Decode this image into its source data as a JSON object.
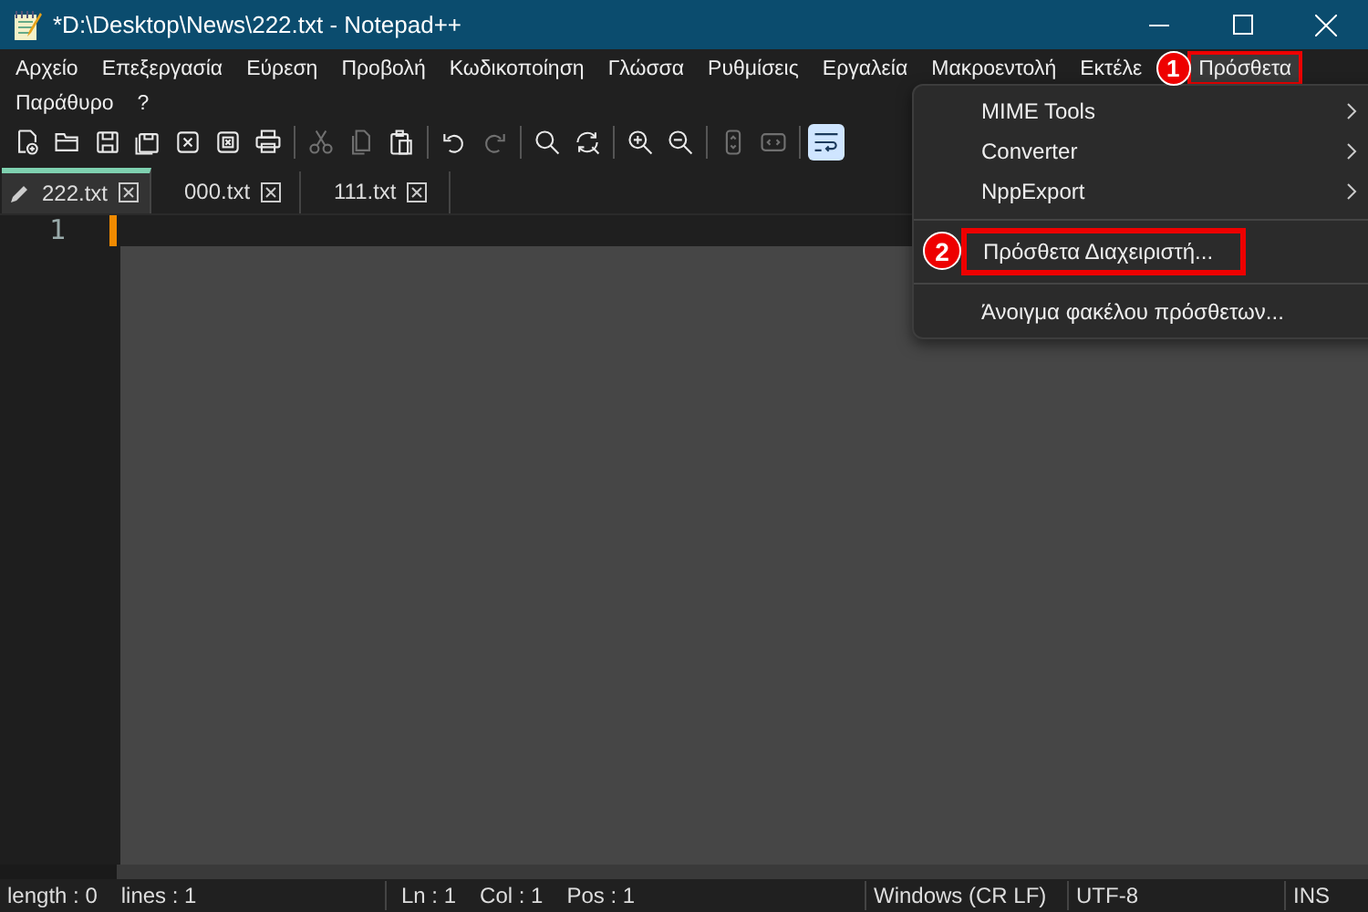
{
  "window": {
    "title": "*D:\\Desktop\\News\\222.txt - Notepad++"
  },
  "menubar": [
    {
      "label": "Αρχείο",
      "selected": false
    },
    {
      "label": "Επεξεργασία",
      "selected": false
    },
    {
      "label": "Εύρεση",
      "selected": false
    },
    {
      "label": "Προβολή",
      "selected": false
    },
    {
      "label": "Κωδικοποίηση",
      "selected": false
    },
    {
      "label": "Γλώσσα",
      "selected": false
    },
    {
      "label": "Ρυθμίσεις",
      "selected": false
    },
    {
      "label": "Εργαλεία",
      "selected": false
    },
    {
      "label": "Μακροεντολή",
      "selected": false
    },
    {
      "label": "Εκτέλε",
      "selected": false
    },
    {
      "label": "Πρόσθετα",
      "selected": true,
      "annotation": "1"
    },
    {
      "label": "Παράθυρο",
      "selected": false
    },
    {
      "label": "?",
      "selected": false
    }
  ],
  "toolbar": [
    [
      {
        "kind": "new",
        "disabled": false,
        "on": false
      },
      {
        "kind": "open",
        "disabled": false,
        "on": false
      },
      {
        "kind": "save",
        "disabled": false,
        "on": false
      },
      {
        "kind": "save-all",
        "disabled": false,
        "on": false
      },
      {
        "kind": "close",
        "disabled": false,
        "on": false
      },
      {
        "kind": "close-all",
        "disabled": false,
        "on": false
      },
      {
        "kind": "print",
        "disabled": false,
        "on": false
      }
    ],
    [
      {
        "kind": "cut",
        "disabled": true,
        "on": false
      },
      {
        "kind": "copy",
        "disabled": true,
        "on": false
      },
      {
        "kind": "paste",
        "disabled": false,
        "on": false
      }
    ],
    [
      {
        "kind": "undo",
        "disabled": false,
        "on": false
      },
      {
        "kind": "redo",
        "disabled": true,
        "on": false
      }
    ],
    [
      {
        "kind": "find",
        "disabled": false,
        "on": false
      },
      {
        "kind": "replace",
        "disabled": false,
        "on": false
      }
    ],
    [
      {
        "kind": "zoom-in",
        "disabled": false,
        "on": false
      },
      {
        "kind": "zoom-out",
        "disabled": false,
        "on": false
      }
    ],
    [
      {
        "kind": "sync-v",
        "disabled": true,
        "on": false
      },
      {
        "kind": "sync-h",
        "disabled": true,
        "on": false
      }
    ],
    [
      {
        "kind": "wrap",
        "disabled": false,
        "on": true
      }
    ]
  ],
  "tabs": [
    {
      "label": "222.txt",
      "selected": true,
      "modified": true
    },
    {
      "label": "000.txt",
      "selected": false,
      "modified": false
    },
    {
      "label": "111.txt",
      "selected": false,
      "modified": false
    }
  ],
  "editor": {
    "line_numbers": [
      "1"
    ]
  },
  "dropdown": [
    {
      "kind": "submenu",
      "label": "MIME Tools",
      "selected": false
    },
    {
      "kind": "submenu",
      "label": "Converter",
      "selected": false
    },
    {
      "kind": "submenu",
      "label": "NppExport",
      "selected": false
    },
    {
      "kind": "separator"
    },
    {
      "kind": "item",
      "label": "Πρόσθετα Διαχειριστή...",
      "annotation": "2",
      "selected": true
    },
    {
      "kind": "separator"
    },
    {
      "kind": "item",
      "label": "Άνοιγμα φακέλου πρόσθετων...",
      "selected": false
    }
  ],
  "status_bar": {
    "length": "length : 0",
    "lines": "lines : 1",
    "ln": "Ln : 1",
    "col": "Col : 1",
    "pos": "Pos : 1",
    "eol": "Windows (CR LF)",
    "encoding": "UTF-8",
    "mode": "INS"
  }
}
